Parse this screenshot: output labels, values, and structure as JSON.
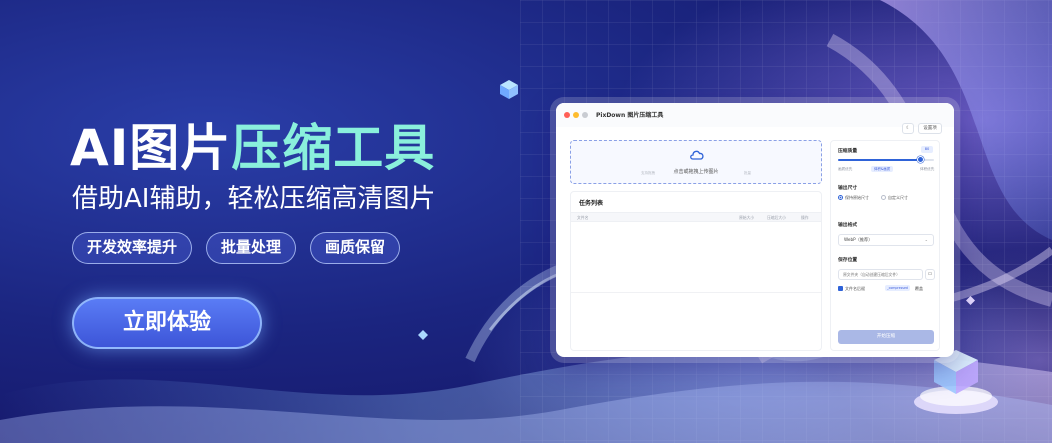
{
  "hero": {
    "title_main": "AI图片",
    "title_accent": "压缩工具",
    "subtitle": "借助AI辅助，轻松压缩高清图片",
    "tags": [
      "开发效率提升",
      "批量处理",
      "画质保留"
    ],
    "cta": "立即体验"
  },
  "app": {
    "window_title": "PixDown 图片压缩工具",
    "toolbar": {
      "theme_icon": "moon-icon",
      "settings_label": "设置项"
    },
    "dropzone": {
      "text": "点击或拖拽上传图片",
      "hint_left": "支持拖拽",
      "hint_right": "批量"
    },
    "tasks": {
      "title": "任务列表",
      "columns": [
        "文件名",
        "原始大小",
        "压缩后大小",
        "操作"
      ]
    },
    "panel": {
      "quality_label": "压缩质量",
      "quality_value": "80",
      "quality_percent": 0.86,
      "quality_min": "画质优先",
      "quality_mid": "体积&画质",
      "quality_max": "体积优先",
      "size_label": "输出尺寸",
      "size_options": [
        "保持原始尺寸",
        "自定义尺寸"
      ],
      "format_label": "输出格式",
      "format_value": "WebP（推荐）",
      "save_label": "保存位置",
      "save_path": "原文件夹（自动创建压缩后文件）",
      "suffix_label": "文件名后缀",
      "suffix_value": "_compressed",
      "suffix_tail": "覆盖",
      "start_button": "开始压缩"
    }
  },
  "colors": {
    "accent_text": "#8af0dc",
    "primary": "#2f63d8",
    "background": "#1b2580"
  }
}
